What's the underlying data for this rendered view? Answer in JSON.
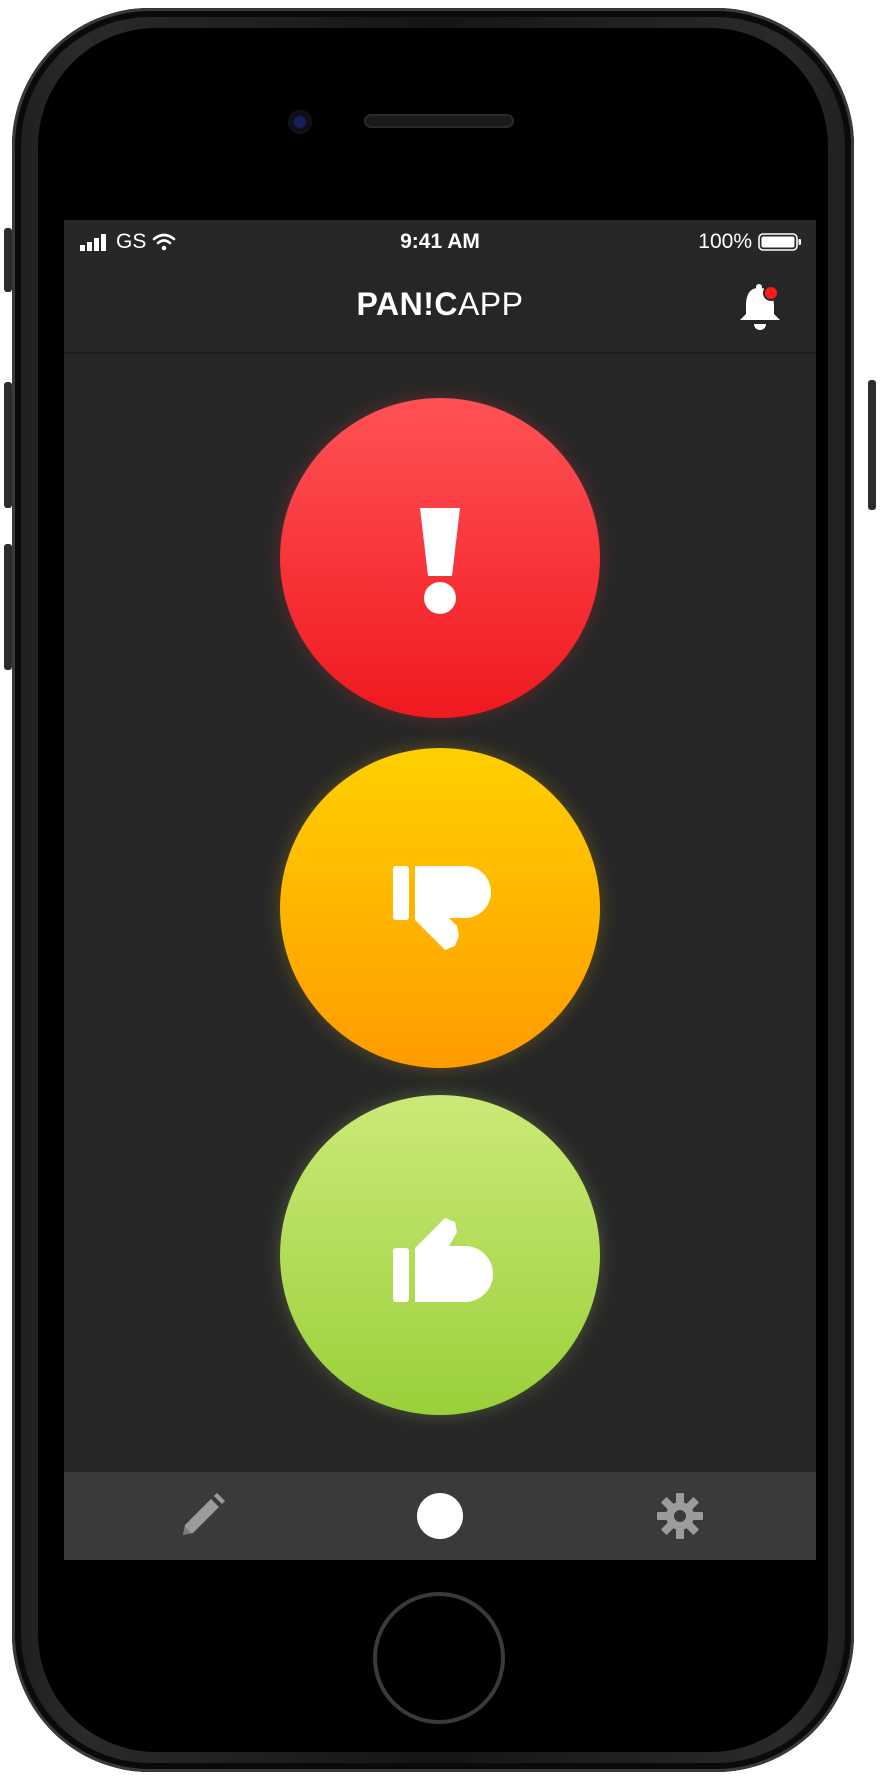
{
  "status_bar": {
    "carrier": "GS",
    "time": "9:41 AM",
    "battery": "100%"
  },
  "header": {
    "logo_bold": "PAN!C",
    "logo_light": "APP",
    "notification_dot_color": "#ff1a1a"
  },
  "buttons": [
    {
      "name": "panic",
      "icon": "exclamation-icon",
      "color_top": "#ff5256",
      "color_bottom": "#f0191f"
    },
    {
      "name": "thumbs-down",
      "icon": "thumbs-down-icon",
      "color_top": "#ffd000",
      "color_bottom": "#ff9b00"
    },
    {
      "name": "thumbs-up",
      "icon": "thumbs-up-icon",
      "color_top": "#cbe978",
      "color_bottom": "#9ad03a"
    }
  ],
  "tabbar": {
    "items": [
      {
        "icon": "pencil-icon",
        "selected": false
      },
      {
        "icon": "home-dot-icon",
        "selected": true
      },
      {
        "icon": "gear-icon",
        "selected": false
      }
    ]
  }
}
